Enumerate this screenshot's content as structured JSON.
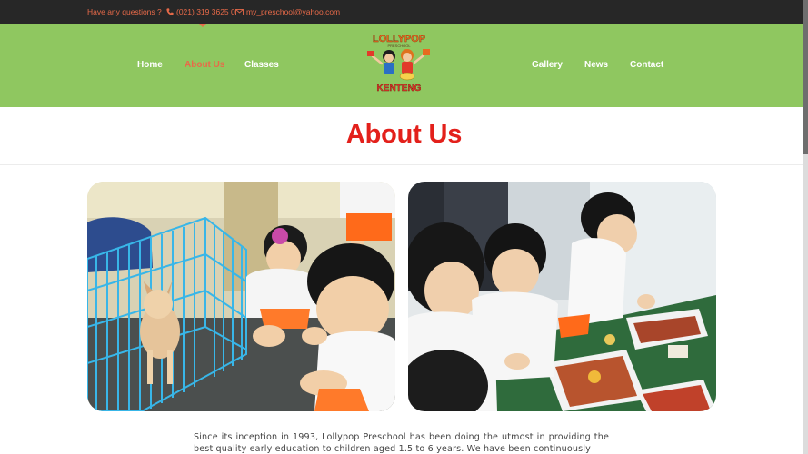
{
  "topbar": {
    "question": "Have any questions ?",
    "phone": "(021) 319 3625 0",
    "email": "my_preschool@yahoo.com"
  },
  "nav": {
    "left": [
      {
        "label": "Home",
        "active": false
      },
      {
        "label": "About Us",
        "active": true
      },
      {
        "label": "Classes",
        "active": false
      }
    ],
    "right": [
      {
        "label": "Gallery"
      },
      {
        "label": "News"
      },
      {
        "label": "Contact"
      }
    ]
  },
  "logo": {
    "text_top": "LOLLYPOP",
    "text_bottom": "KENTENG"
  },
  "page": {
    "title": "About Us",
    "intro": "Since its inception in 1993, Lollypop Preschool has been doing the utmost in providing the best quality early education to children aged 1.5 to 6 years. We have been continuously"
  },
  "icons": {
    "phone": "phone-icon",
    "email": "envelope-icon"
  },
  "colors": {
    "accent": "#e86a49",
    "header_green": "#8fc760",
    "title_red": "#e3201b",
    "topbar": "#272727"
  }
}
